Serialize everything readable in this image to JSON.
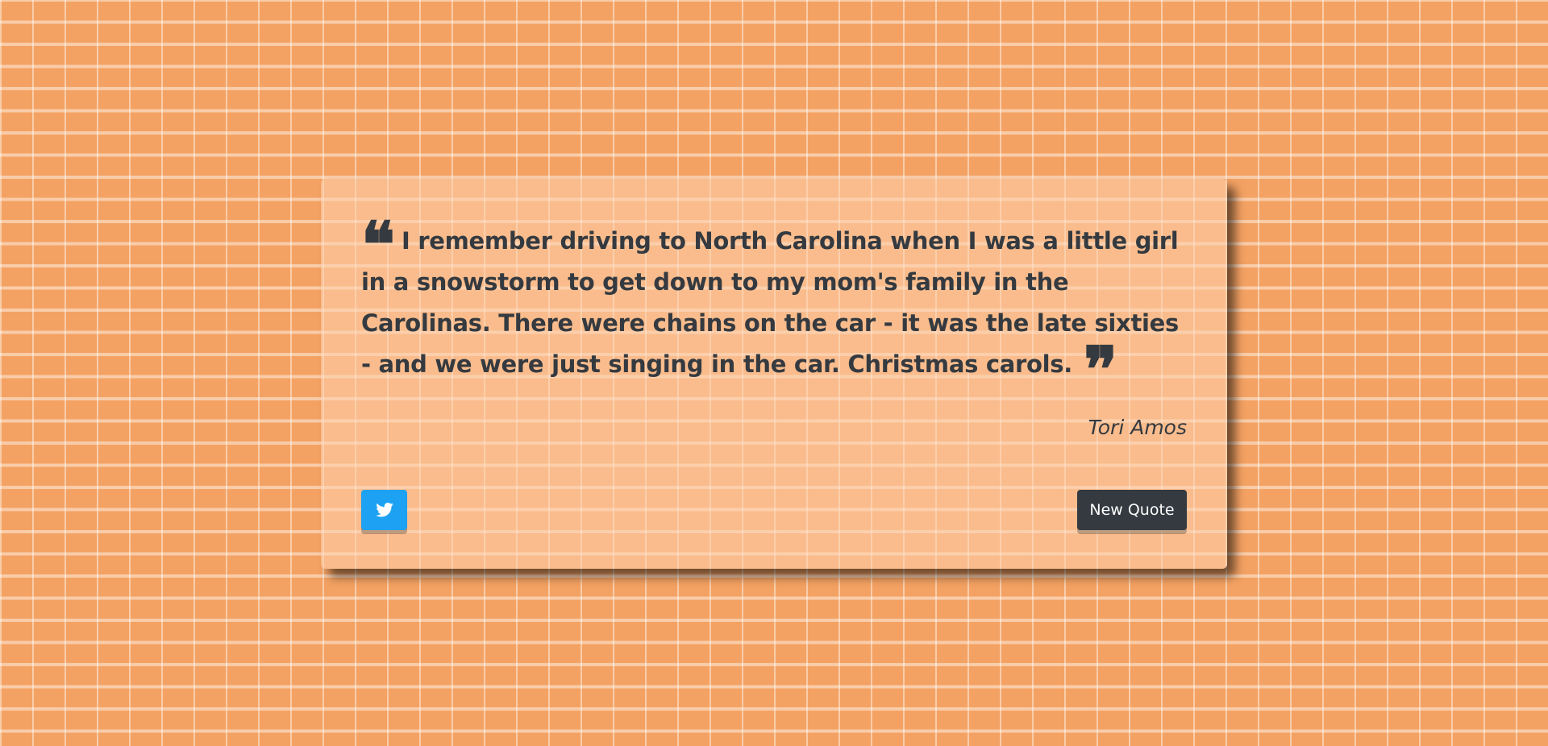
{
  "quote": {
    "open_mark": "❝",
    "text": "I remember driving to North Carolina when I was a little girl in a snowstorm to get down to my mom's family in the Carolinas. There were chains on the car - it was the late sixties - and we were just singing in the car. Christmas carols.",
    "close_mark": "❞",
    "author": "Tori Amos"
  },
  "actions": {
    "tweet_icon": "twitter-icon",
    "new_quote_label": "New Quote"
  },
  "colors": {
    "background": "#f4a263",
    "text": "#343a40",
    "twitter": "#1da1f2",
    "button_dark": "#343a40"
  }
}
